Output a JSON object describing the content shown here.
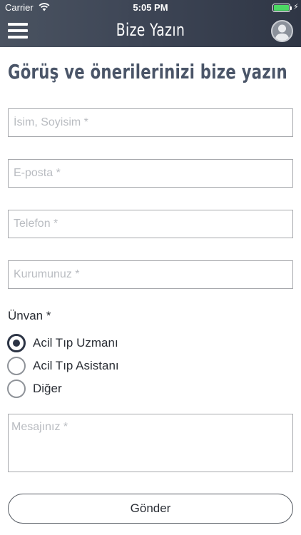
{
  "status_bar": {
    "carrier": "Carrier",
    "time": "5:05 PM",
    "battery_level": 1.0,
    "battery_color": "#4cd964",
    "wifi_icon": "wifi-icon",
    "charging_icon": "bolt-icon"
  },
  "navbar": {
    "title": "Bize Yazın",
    "menu_icon": "hamburger-menu-icon",
    "profile_icon": "user-avatar-icon",
    "gradient": [
      "#4a5361",
      "#2f3645"
    ]
  },
  "form": {
    "heading": "Görüş ve önerilerinizi bize yazın",
    "name_placeholder": "İsim, Soyisim *",
    "email_placeholder": "E-posta *",
    "phone_placeholder": "Telefon *",
    "institution_placeholder": "Kurumunuz *",
    "title_label": "Ünvan *",
    "title_options": [
      {
        "label": "Acil Tıp Uzmanı",
        "selected": true
      },
      {
        "label": "Acil Tıp Asistanı",
        "selected": false
      },
      {
        "label": "Diğer",
        "selected": false
      }
    ],
    "message_placeholder": "Mesajınız *",
    "submit_label": "Gönder"
  }
}
